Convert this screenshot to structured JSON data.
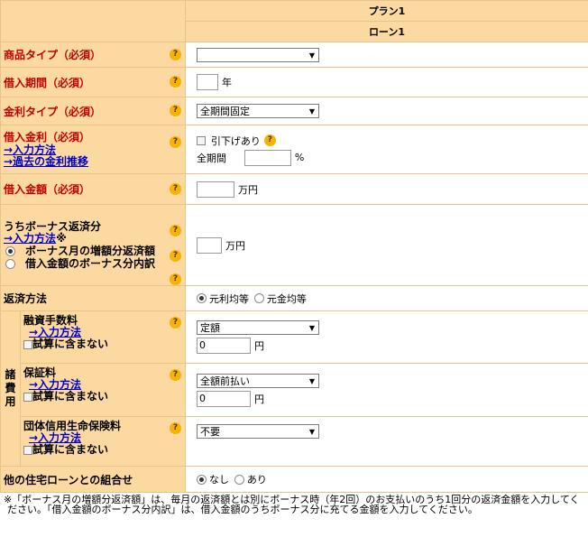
{
  "header": {
    "plan": "プラン1",
    "loan": "ローン1"
  },
  "product_type": {
    "label": "商品タイプ（必須）",
    "value": ""
  },
  "period": {
    "label": "借入期間（必須）",
    "value": "",
    "unit": "年"
  },
  "rate_type": {
    "label": "金利タイプ（必須）",
    "value": "全期間固定"
  },
  "rate": {
    "label": "借入金利（必須）",
    "link1": "→入力方法",
    "link2": "→過去の金利推移",
    "discount_label": "引下げあり",
    "period_label": "全期間",
    "value": "",
    "unit": "%"
  },
  "amount": {
    "label": "借入金額（必須）",
    "value": "",
    "unit": "万円"
  },
  "bonus": {
    "label": "うちボーナス返済分",
    "link": "→入力方法",
    "mark": "※",
    "opt1": "ボーナス月の増額分返済額",
    "opt2": "借入金額のボーナス分内訳",
    "value": "",
    "unit": "万円"
  },
  "repay": {
    "label": "返済方法",
    "opt1": "元利均等",
    "opt2": "元金均等"
  },
  "costs": {
    "group_label": "諸費用",
    "fee": {
      "label": "融資手数料",
      "link": "→入力方法",
      "exclude": "試算に含まない",
      "select": "定額",
      "value": "0",
      "unit": "円"
    },
    "guarantee": {
      "label": "保証料",
      "link": "→入力方法",
      "exclude": "試算に含まない",
      "select": "全額前払い",
      "value": "0",
      "unit": "円"
    },
    "insurance": {
      "label": "団体信用生命保険料",
      "link": "→入力方法",
      "exclude": "試算に含まない",
      "select": "不要"
    }
  },
  "combo": {
    "label": "他の住宅ローンとの組合せ",
    "opt1": "なし",
    "opt2": "あり"
  },
  "footnote": "※「ボーナス月の増額分返済額」は、毎月の返済額とは別にボーナス時（年2回）のお支払いのうち1回分の返済金額を入力してください。「借入金額のボーナス分内訳」は、借入金額のうちボーナス分に充てる金額を入力してください。",
  "icons": {
    "help": "help-question-icon",
    "dropdown": "chevron-down-icon"
  },
  "colors": {
    "label_bg": "#fcd9a1",
    "required_text": "#c00000",
    "link": "#0000cc",
    "help": "#f5b400"
  }
}
